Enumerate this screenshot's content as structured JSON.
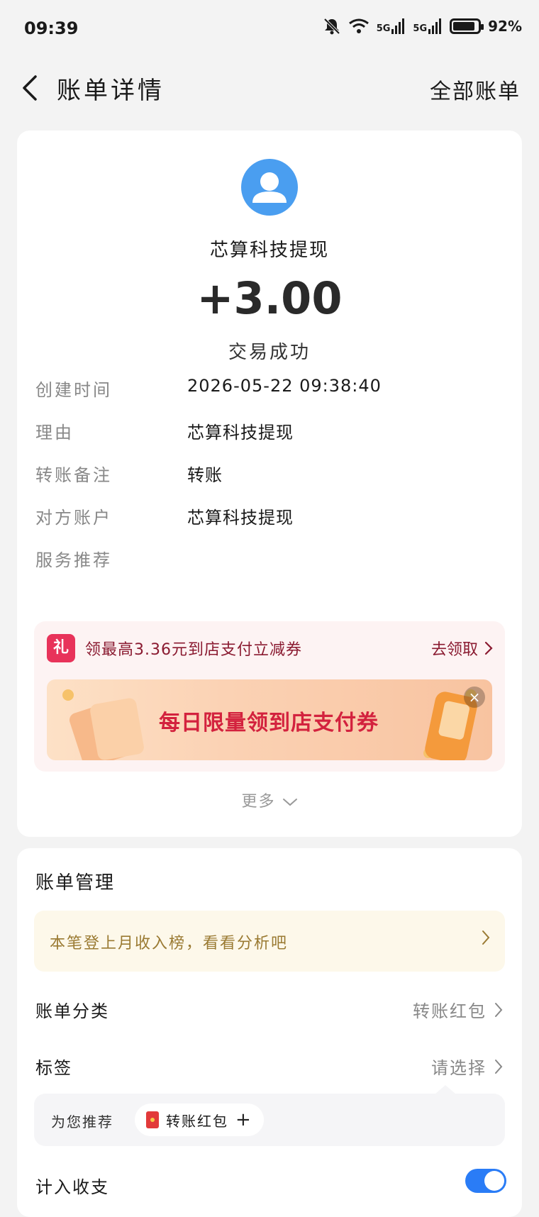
{
  "status_bar": {
    "time": "09:39",
    "battery": "92%",
    "signal1": "5G",
    "signal2": "5G"
  },
  "nav": {
    "title": "账单详情",
    "right_link": "全部账单"
  },
  "transaction": {
    "payee": "芯算科技提现",
    "amount": "+3.00",
    "status": "交易成功",
    "details": [
      {
        "label": "创建时间",
        "value": "2026-05-22 09:38:40"
      },
      {
        "label": "理由",
        "value": "芯算科技提现"
      },
      {
        "label": "转账备注",
        "value": "转账"
      },
      {
        "label": "对方账户",
        "value": "芯算科技提现"
      },
      {
        "label": "服务推荐",
        "value": ""
      }
    ]
  },
  "promo": {
    "gift_glyph": "礼",
    "text": "领最高3.36元到店支付立减券",
    "action": "去领取",
    "banner_text": "每日限量领到店支付券",
    "close_glyph": "×"
  },
  "more": {
    "label": "更多"
  },
  "manage": {
    "title": "账单管理",
    "hint": "本笔登上月收入榜，看看分析吧",
    "category_label": "账单分类",
    "category_value": "转账红包",
    "tag_label": "标签",
    "tag_value": "请选择",
    "recommend_label": "为您推荐",
    "chip_label": "转账红包",
    "plus_glyph": "+",
    "count_label": "计入收支"
  }
}
